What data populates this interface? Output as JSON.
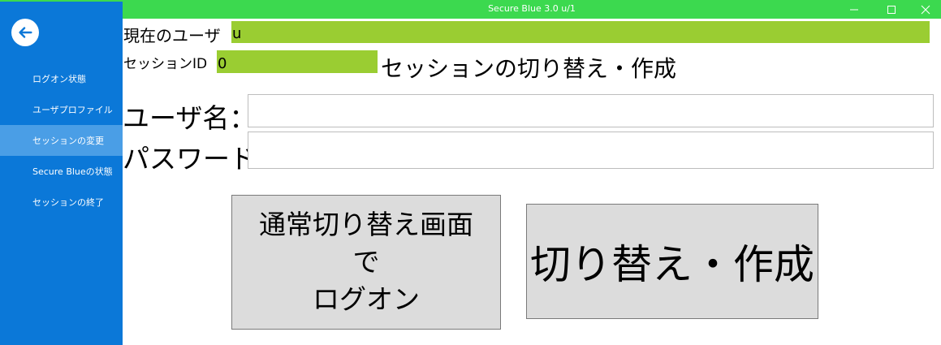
{
  "window": {
    "title": "Secure Blue 3.0 u/1",
    "controls": {
      "minimize": "minimize-icon",
      "maximize": "maximize-icon",
      "close": "close-icon"
    }
  },
  "sidebar": {
    "back_icon": "back-arrow-icon",
    "items": [
      {
        "label": "ログオン状態",
        "active": false
      },
      {
        "label": "ユーザプロファイル",
        "active": false
      },
      {
        "label": "セッションの変更",
        "active": true
      },
      {
        "label": "Secure Blueの状態",
        "active": false
      },
      {
        "label": "セッションの終了",
        "active": false
      }
    ]
  },
  "main": {
    "current_user_label": "現在のユーザ",
    "current_user_value": "u",
    "session_id_label": "セッションID",
    "session_id_value": "0",
    "section_title": "セッションの切り替え・作成",
    "username_label": "ユーザ名：",
    "username_value": "",
    "password_label": "パスワード：",
    "password_value": "",
    "normal_logon_button": [
      "通常切り替え画面",
      "で",
      "ログオン"
    ],
    "switch_create_button": "切り替え・作成"
  },
  "colors": {
    "titlebar": "#3cd94f",
    "sidebar": "#0b78d8",
    "sidebar_active": "#4a9ee6",
    "value_highlight": "#9acd32",
    "button": "#dcdcdc"
  }
}
